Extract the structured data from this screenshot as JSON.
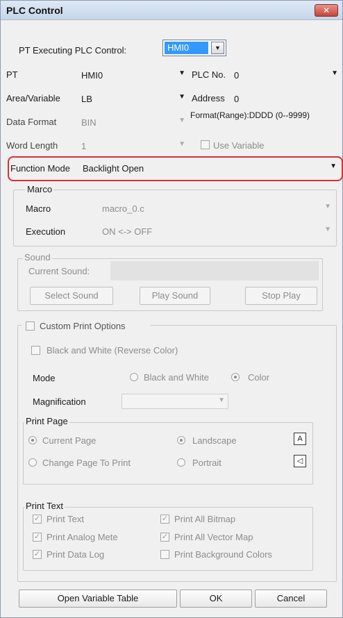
{
  "window": {
    "title": "PLC Control",
    "close_icon": "close-icon"
  },
  "pt_exec": {
    "label": "PT Executing PLC Control:",
    "value": "HMI0"
  },
  "pt": {
    "label": "PT",
    "value": "HMI0"
  },
  "plc_no": {
    "label": "PLC No.",
    "value": "0"
  },
  "area": {
    "label": "Area/Variable",
    "value": "LB"
  },
  "address": {
    "label": "Address",
    "value": "0"
  },
  "data_format": {
    "label": "Data  Format",
    "value": "BIN",
    "format_range": "Format(Range):DDDD (0--9999)"
  },
  "word_length": {
    "label": "Word Length",
    "value": "1",
    "use_variable": "Use Variable"
  },
  "function_mode": {
    "label": "Function Mode",
    "value": "Backlight Open",
    "highlight_color": "#d63035"
  },
  "marco": {
    "title": "Marco",
    "macro_label": "Macro",
    "macro_value": "macro_0.c",
    "execution_label": "Execution",
    "execution_value": "ON <-> OFF"
  },
  "sound": {
    "title": "Sound",
    "current_label": "Current Sound:",
    "select": "Select Sound",
    "play": "Play Sound",
    "stop": "Stop Play"
  },
  "print": {
    "custom_label": "Custom Print Options",
    "bw_reverse": "Black and White (Reverse Color)",
    "mode_label": "Mode",
    "mode_bw": "Black and White",
    "mode_color": "Color",
    "magnification_label": "Magnification",
    "page_title": "Print Page",
    "current_page": "Current Page",
    "landscape": "Landscape",
    "change_page": "Change Page To Print",
    "portrait": "Portrait",
    "text_title": "Print Text",
    "print_text": "Print Text",
    "print_all_bitmap": "Print All Bitmap",
    "print_analog": "Print Analog Mete",
    "print_vector": "Print All Vector Map",
    "print_datalog": "Print Data Log",
    "print_bg": "Print Background Colors"
  },
  "footer": {
    "open_table": "Open Variable Table",
    "ok": "OK",
    "cancel": "Cancel"
  }
}
